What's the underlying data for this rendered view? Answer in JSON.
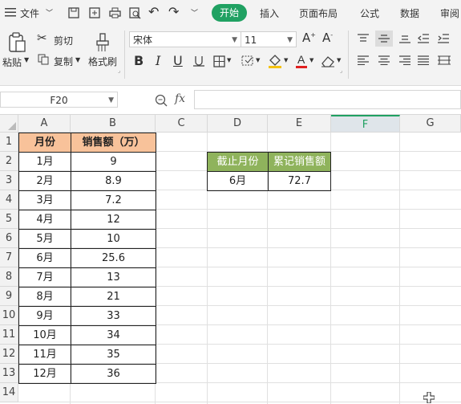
{
  "menu": {
    "file_label": "文件",
    "tabs": [
      {
        "label": "开始",
        "active": true
      },
      {
        "label": "插入"
      },
      {
        "label": "页面布局"
      },
      {
        "label": "公式"
      },
      {
        "label": "数据"
      },
      {
        "label": "审阅"
      }
    ]
  },
  "ribbon": {
    "paste_label": "粘贴",
    "cut_label": "剪切",
    "copy_label": "复制",
    "format_painter_label": "格式刷",
    "font_name": "宋体",
    "font_size": "11"
  },
  "formula_bar": {
    "name_box": "F20",
    "fx_label": "fx",
    "formula": ""
  },
  "columns": [
    "A",
    "B",
    "C",
    "D",
    "E",
    "F",
    "G"
  ],
  "selected_column": "F",
  "rows": [
    "1",
    "2",
    "3",
    "4",
    "5",
    "6",
    "7",
    "8",
    "9",
    "10",
    "11",
    "12",
    "13",
    "14"
  ],
  "table1": {
    "header": [
      "月份",
      "销售额（万）"
    ],
    "rows": [
      [
        "1月",
        "9"
      ],
      [
        "2月",
        "8.9"
      ],
      [
        "3月",
        "7.2"
      ],
      [
        "4月",
        "12"
      ],
      [
        "5月",
        "10"
      ],
      [
        "6月",
        "25.6"
      ],
      [
        "7月",
        "13"
      ],
      [
        "8月",
        "21"
      ],
      [
        "9月",
        "33"
      ],
      [
        "10月",
        "34"
      ],
      [
        "11月",
        "35"
      ],
      [
        "12月",
        "36"
      ]
    ]
  },
  "table2": {
    "header": [
      "截止月份",
      "累记销售额"
    ],
    "row": [
      "6月",
      "72.7"
    ]
  },
  "colors": {
    "accent": "#20a162",
    "header_orange": "#f8c29a",
    "header_green": "#8fb35c"
  }
}
